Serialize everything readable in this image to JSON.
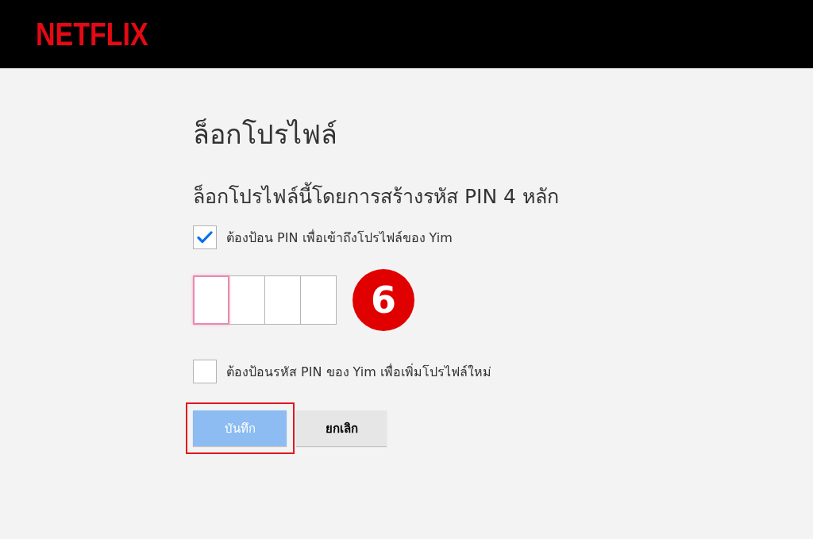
{
  "header": {
    "logo": "NETFLIX"
  },
  "title": "ล็อกโปรไฟล์",
  "subtitle": "ล็อกโปรไฟล์นี้โดยการสร้างรหัส PIN 4 หลัก",
  "pin_option": {
    "label": "ต้องป้อน PIN เพื่อเข้าถึงโปรไฟล์ของ Yim",
    "checked": true
  },
  "pin_fields": [
    {
      "focused": true
    },
    {
      "focused": false
    },
    {
      "focused": false
    },
    {
      "focused": false
    }
  ],
  "step_badge": "6",
  "new_profile_option": {
    "label": "ต้องป้อนรหัส PIN ของ Yim เพื่อเพิ่มโปรไฟล์ใหม่",
    "checked": false
  },
  "buttons": [
    {
      "label": "บันทึก",
      "kind": "primary",
      "disabled": true,
      "highlighted": true
    },
    {
      "label": "ยกเลิก",
      "kind": "secondary",
      "disabled": false,
      "highlighted": false
    }
  ]
}
